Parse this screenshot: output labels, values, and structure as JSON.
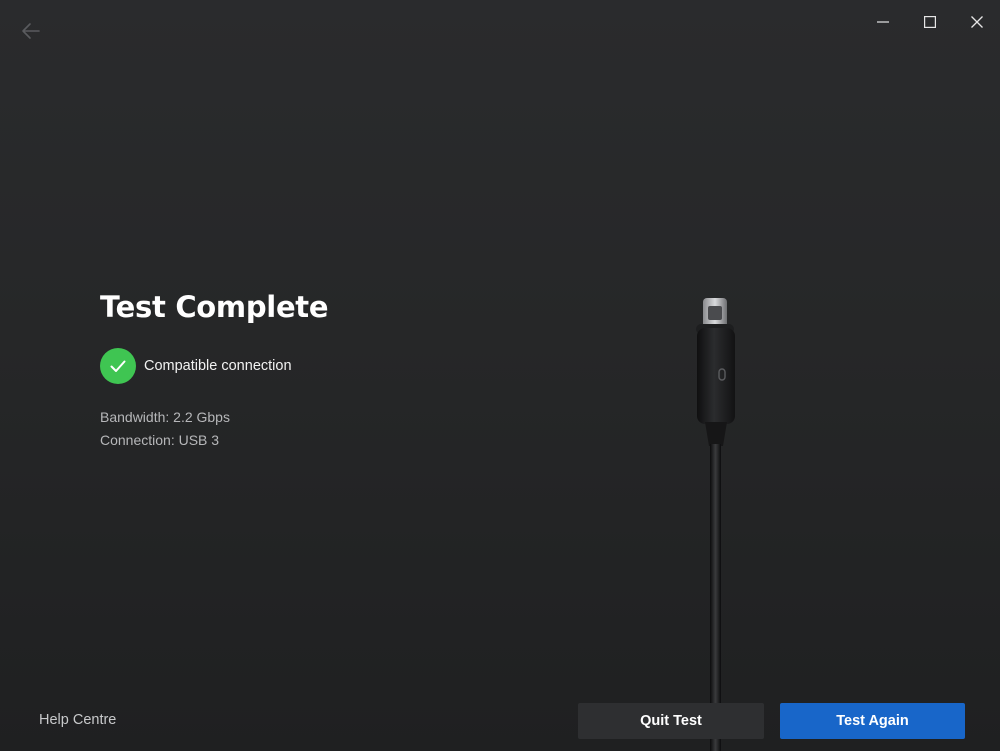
{
  "header": {
    "back_icon": "arrow-left-icon",
    "window_controls": {
      "minimize_icon": "minimize-icon",
      "maximize_icon": "maximize-icon",
      "close_icon": "close-icon"
    }
  },
  "main": {
    "title": "Test Complete",
    "status": {
      "icon": "check-icon",
      "text": "Compatible connection",
      "color": "#3fc552"
    },
    "details": {
      "bandwidth": "Bandwidth: 2.2 Gbps",
      "connection": "Connection: USB 3"
    },
    "illustration_icon": "usb-c-cable-icon"
  },
  "footer": {
    "help_label": "Help Centre",
    "quit_label": "Quit Test",
    "again_label": "Test Again",
    "accent_color": "#1866c9"
  }
}
